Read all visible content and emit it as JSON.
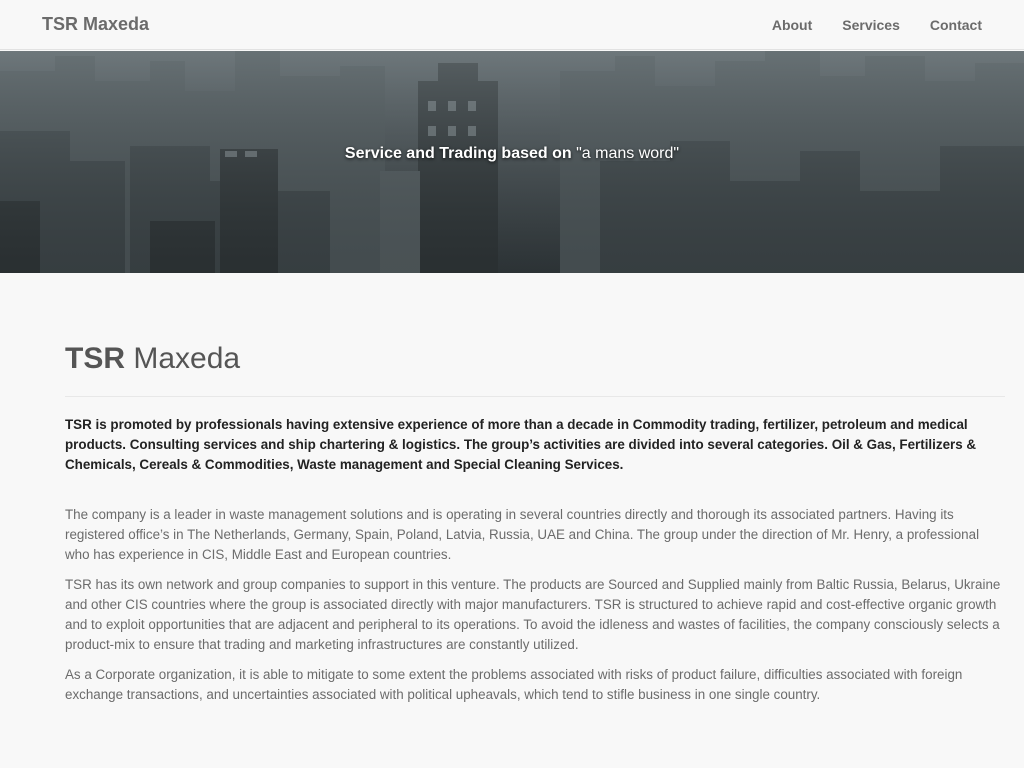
{
  "nav": {
    "brand": "TSR Maxeda",
    "links": [
      "About",
      "Services",
      "Contact"
    ]
  },
  "hero": {
    "bold": "Service and Trading based on",
    "quote": "\"a mans word\""
  },
  "main": {
    "title_bold": "TSR",
    "title_rest": "Maxeda",
    "lead": "TSR is promoted by professionals having extensive experience of more than a decade in Commodity trading, fertilizer, petroleum and medical products. Consulting services and ship chartering & logistics. The group’s activities are divided into several categories. Oil & Gas, Fertilizers & Chemicals, Cereals & Commodities, Waste management and Special Cleaning Services.",
    "paragraphs": [
      "The company is a leader in waste management solutions and is operating in several countries directly and thorough its associated partners. Having its registered office’s in The Netherlands, Germany, Spain, Poland, Latvia, Russia, UAE and China. The group under the direction of Mr. Henry, a professional who has experience in CIS, Middle East and European countries.",
      "TSR has its own network and group companies to support in this venture. The products are Sourced and Supplied mainly from Baltic Russia, Belarus, Ukraine and other CIS countries where the group is associated directly with major manufacturers. TSR is structured to achieve rapid and cost-effective organic growth and to exploit opportunities that are adjacent and peripheral to its operations. To avoid the idleness and wastes of facilities, the company consciously selects a product-mix to ensure that trading and marketing infrastructures are constantly utilized.",
      "As a Corporate organization, it is able to mitigate to some extent the problems associated with risks of product failure, difficulties associated with foreign exchange transactions, and uncertainties associated with political upheavals, which tend to stifle business in one single country."
    ]
  }
}
